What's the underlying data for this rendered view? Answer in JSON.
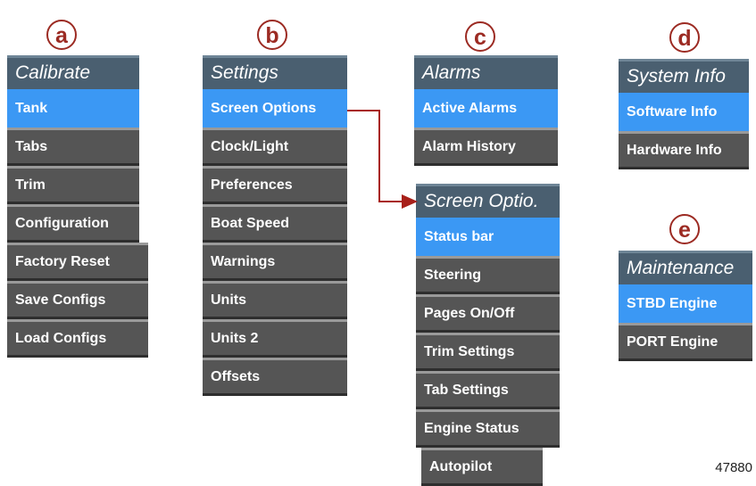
{
  "labels": {
    "a": "a",
    "b": "b",
    "c": "c",
    "d": "d",
    "e": "e"
  },
  "calibrate": {
    "title": "Calibrate",
    "items": [
      "Tank",
      "Tabs",
      "Trim",
      "Configuration",
      "Factory Reset",
      "Save Configs",
      "Load Configs"
    ],
    "selected": 0
  },
  "settings": {
    "title": "Settings",
    "items": [
      "Screen Options",
      "Clock/Light",
      "Preferences",
      "Boat Speed",
      "Warnings",
      "Units",
      "Units 2",
      "Offsets"
    ],
    "selected": 0
  },
  "alarms": {
    "title": "Alarms",
    "items": [
      "Active Alarms",
      "Alarm History"
    ],
    "selected": 0
  },
  "screen_options": {
    "title": "Screen Optio.",
    "items": [
      "Status bar",
      "Steering",
      "Pages On/Off",
      "Trim Settings",
      "Tab Settings",
      "Engine Status",
      "Autopilot"
    ],
    "selected": 0
  },
  "system_info": {
    "title": "System Info",
    "items": [
      "Software Info",
      "Hardware Info"
    ],
    "selected": 0
  },
  "maintenance": {
    "title": "Maintenance",
    "items": [
      "STBD Engine",
      "PORT Engine"
    ],
    "selected": 0
  },
  "figure_number": "47880",
  "colors": {
    "title_bar": "#4a5f70",
    "item": "#555555",
    "selected": "#3b98f4",
    "badge": "#9c2b23",
    "arrow": "#a8201a"
  }
}
